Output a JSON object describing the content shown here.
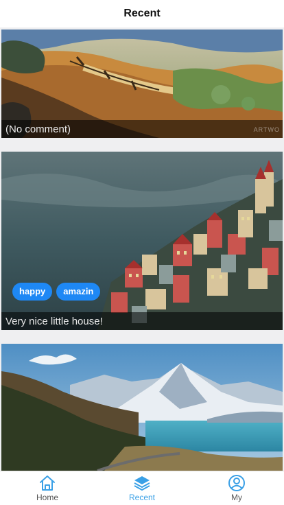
{
  "header": {
    "title": "Recent"
  },
  "feed": {
    "cards": [
      {
        "caption": "(No comment)",
        "tags": [],
        "watermark": "ARTWO"
      },
      {
        "caption": "Very nice little house!",
        "tags": [
          "happy",
          "amazin"
        ]
      },
      {
        "caption": "",
        "tags": []
      }
    ]
  },
  "tabbar": {
    "items": [
      {
        "label": "Home",
        "icon": "home-icon",
        "active": false
      },
      {
        "label": "Recent",
        "icon": "layers-icon",
        "active": true
      },
      {
        "label": "My",
        "icon": "user-circle-icon",
        "active": false
      }
    ],
    "colors": {
      "active": "#3aa0e6",
      "inactive": "#555555"
    }
  },
  "colors": {
    "tag": "#1e88f5",
    "feed_background": "#efeff1"
  }
}
